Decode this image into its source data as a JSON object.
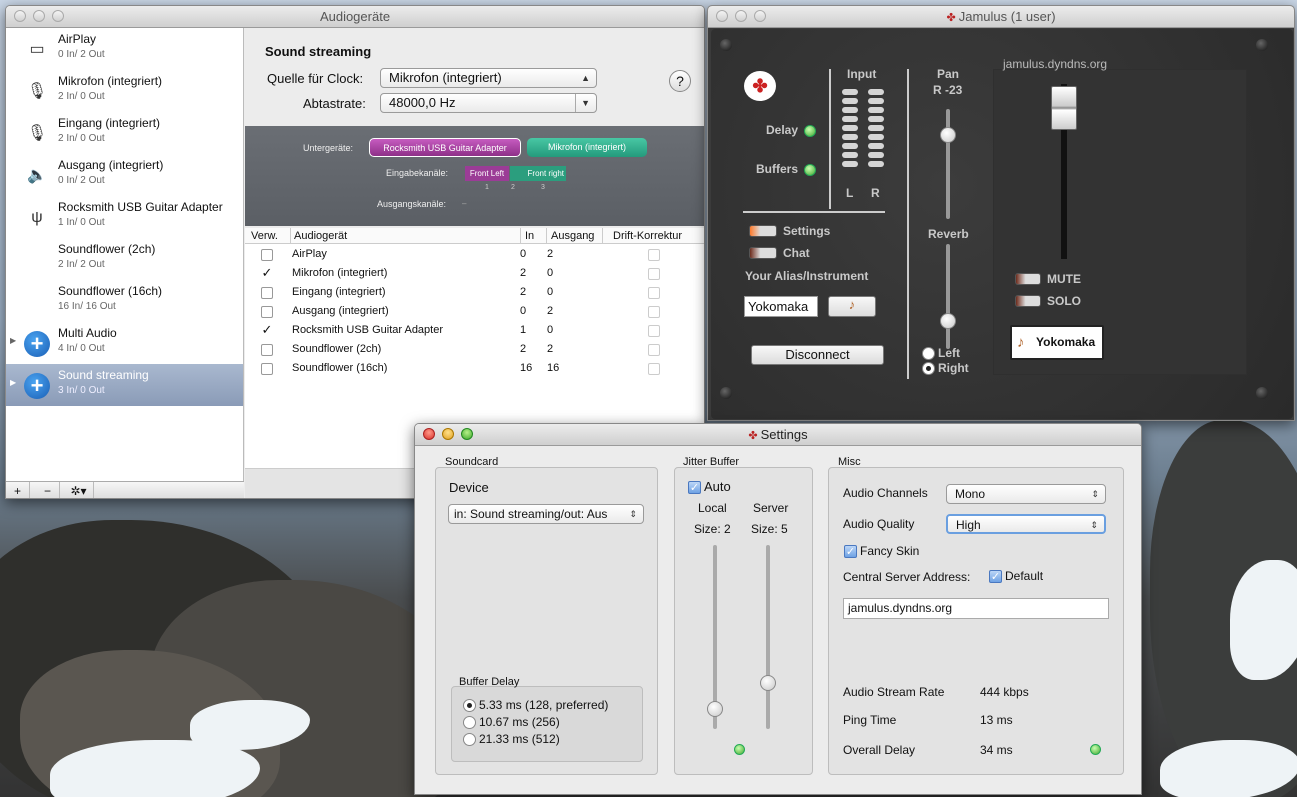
{
  "audio_window": {
    "title": "Audiogeräte",
    "devices": [
      {
        "name": "AirPlay",
        "io": "0 In/ 2 Out"
      },
      {
        "name": "Mikrofon (integriert)",
        "io": "2 In/ 0 Out"
      },
      {
        "name": "Eingang (integriert)",
        "io": "2 In/ 0 Out"
      },
      {
        "name": "Ausgang (integriert)",
        "io": "0 In/ 2 Out"
      },
      {
        "name": "Rocksmith USB Guitar Adapter",
        "io": "1 In/ 0 Out"
      },
      {
        "name": "Soundflower (2ch)",
        "io": "2 In/ 2 Out"
      },
      {
        "name": "Soundflower (16ch)",
        "io": "16 In/ 16 Out"
      },
      {
        "name": "Multi Audio",
        "io": "4 In/ 0 Out"
      },
      {
        "name": "Sound streaming",
        "io": "3 In/ 0 Out"
      }
    ],
    "bottom_buttons": {
      "add": "+",
      "remove": "−",
      "gear": "✲▾"
    },
    "heading": "Sound streaming",
    "clock_label": "Quelle für Clock:",
    "clock_value": "Mikrofon (integriert)",
    "rate_label": "Abtastrate:",
    "rate_value": "48000,0 Hz",
    "help": "?",
    "sub_label": "Untergeräte:",
    "sub_devices": [
      "Rocksmith USB Guitar Adapter",
      "Mikrofon (integriert)"
    ],
    "in_ch_label": "Eingabekanäle:",
    "in_channels": [
      "Front Left",
      "Front right"
    ],
    "in_ch_numbers": [
      "1",
      "2",
      "3"
    ],
    "out_ch_label": "Ausgangskanäle:",
    "out_ch_value": "–",
    "table_headers": [
      "Verw.",
      "Audiogerät",
      "In",
      "Ausgang",
      "Drift-Korrektur"
    ],
    "table_rows": [
      {
        "check": "",
        "name": "AirPlay",
        "in": "0",
        "out": "2"
      },
      {
        "check": "✓",
        "name": "Mikrofon (integriert)",
        "in": "2",
        "out": "0"
      },
      {
        "check": "",
        "name": "Eingang (integriert)",
        "in": "2",
        "out": "0"
      },
      {
        "check": "",
        "name": "Ausgang (integriert)",
        "in": "0",
        "out": "2"
      },
      {
        "check": "✓",
        "name": "Rocksmith USB Guitar Adapter",
        "in": "1",
        "out": "0"
      },
      {
        "check": "",
        "name": "Soundflower (2ch)",
        "in": "2",
        "out": "2"
      },
      {
        "check": "",
        "name": "Soundflower (16ch)",
        "in": "16",
        "out": "16"
      }
    ]
  },
  "jamulus": {
    "title": "Jamulus (1 user)",
    "input_label": "Input",
    "l": "L",
    "r": "R",
    "delay": "Delay",
    "buffers": "Buffers",
    "settings": "Settings",
    "chat": "Chat",
    "alias_label": "Your Alias/Instrument",
    "alias_value": "Yokomaka",
    "disconnect": "Disconnect",
    "pan_label": "Pan",
    "pan_value": "R -23",
    "reverb_label": "Reverb",
    "left": "Left",
    "right": "Right",
    "server": "jamulus.dyndns.org",
    "mute": "MUTE",
    "solo": "SOLO",
    "user_name": "Yokomaka"
  },
  "settings": {
    "title": "Settings",
    "soundcard_label": "Soundcard",
    "device_label": "Device",
    "device_value": "in: Sound streaming/out: Aus",
    "buffer_delay_label": "Buffer Delay",
    "buffer_options": [
      "5.33 ms (128, preferred)",
      "10.67 ms (256)",
      "21.33 ms (512)"
    ],
    "jitter_label": "Jitter Buffer",
    "auto_label": "Auto",
    "local_label": "Local",
    "local_size": "Size: 2",
    "server_label": "Server",
    "server_size": "Size: 5",
    "misc_label": "Misc",
    "channels_label": "Audio Channels",
    "channels_value": "Mono",
    "quality_label": "Audio Quality",
    "quality_value": "High",
    "fancy_skin": "Fancy Skin",
    "central_label": "Central Server Address:",
    "default_label": "Default",
    "central_value": "jamulus.dyndns.org",
    "stream_rate_label": "Audio Stream Rate",
    "stream_rate_value": "444 kbps",
    "ping_label": "Ping Time",
    "ping_value": "13 ms",
    "overall_label": "Overall Delay",
    "overall_value": "34 ms"
  }
}
